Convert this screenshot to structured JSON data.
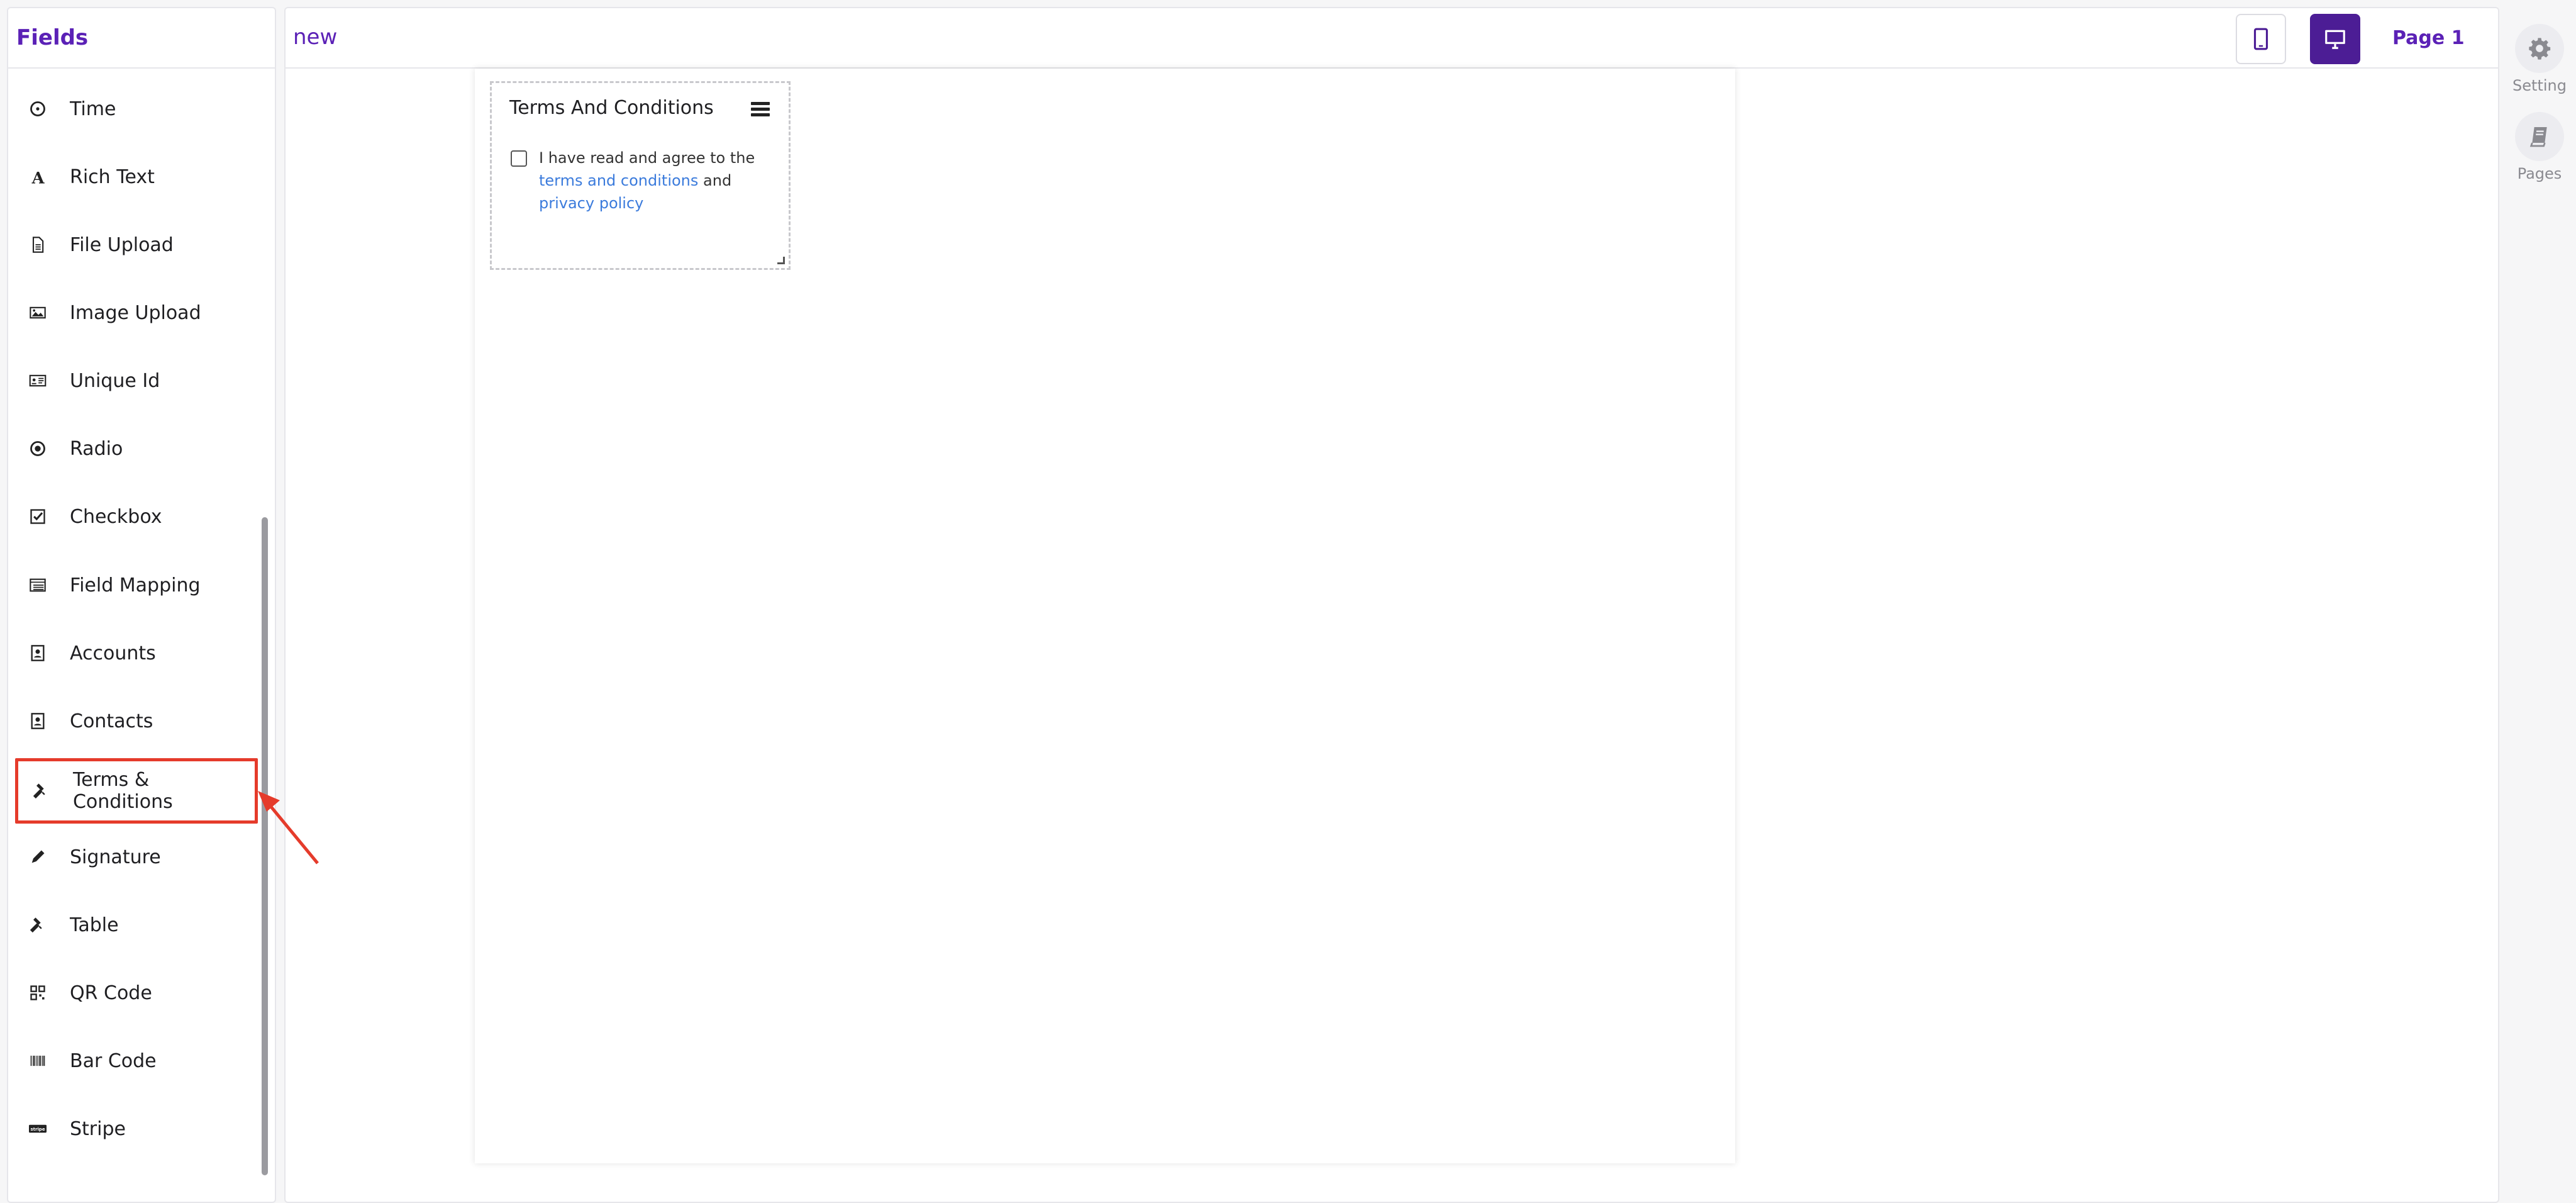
{
  "sidebar": {
    "title": "Fields",
    "items": [
      {
        "label": "Time",
        "icon": "clock-icon"
      },
      {
        "label": "Rich Text",
        "icon": "rich-text-icon"
      },
      {
        "label": "File Upload",
        "icon": "file-icon"
      },
      {
        "label": "Image Upload",
        "icon": "image-icon"
      },
      {
        "label": "Unique Id",
        "icon": "id-card-icon"
      },
      {
        "label": "Radio",
        "icon": "radio-icon"
      },
      {
        "label": "Checkbox",
        "icon": "checkbox-icon"
      },
      {
        "label": "Field Mapping",
        "icon": "field-mapping-icon"
      },
      {
        "label": "Accounts",
        "icon": "account-icon"
      },
      {
        "label": "Contacts",
        "icon": "contact-icon"
      },
      {
        "label": "Terms & Conditions",
        "icon": "gavel-icon",
        "highlighted": true
      },
      {
        "label": "Signature",
        "icon": "pen-icon"
      },
      {
        "label": "Table",
        "icon": "gavel-icon"
      },
      {
        "label": "QR Code",
        "icon": "qr-code-icon"
      },
      {
        "label": "Bar Code",
        "icon": "barcode-icon"
      },
      {
        "label": "Stripe",
        "icon": "stripe-icon"
      }
    ]
  },
  "header": {
    "form_name": "new",
    "page_label": "Page 1"
  },
  "widget": {
    "title": "Terms And Conditions",
    "text_before": "I have read and agree to the",
    "link_terms": "terms and conditions",
    "text_mid": "and",
    "link_privacy": "privacy policy"
  },
  "rail": {
    "setting_label": "Setting",
    "pages_label": "Pages"
  },
  "colors": {
    "accent": "#5b21b6",
    "accent_dark": "#4c1d95",
    "highlight": "#e53b2b",
    "link": "#3b7bdc"
  }
}
